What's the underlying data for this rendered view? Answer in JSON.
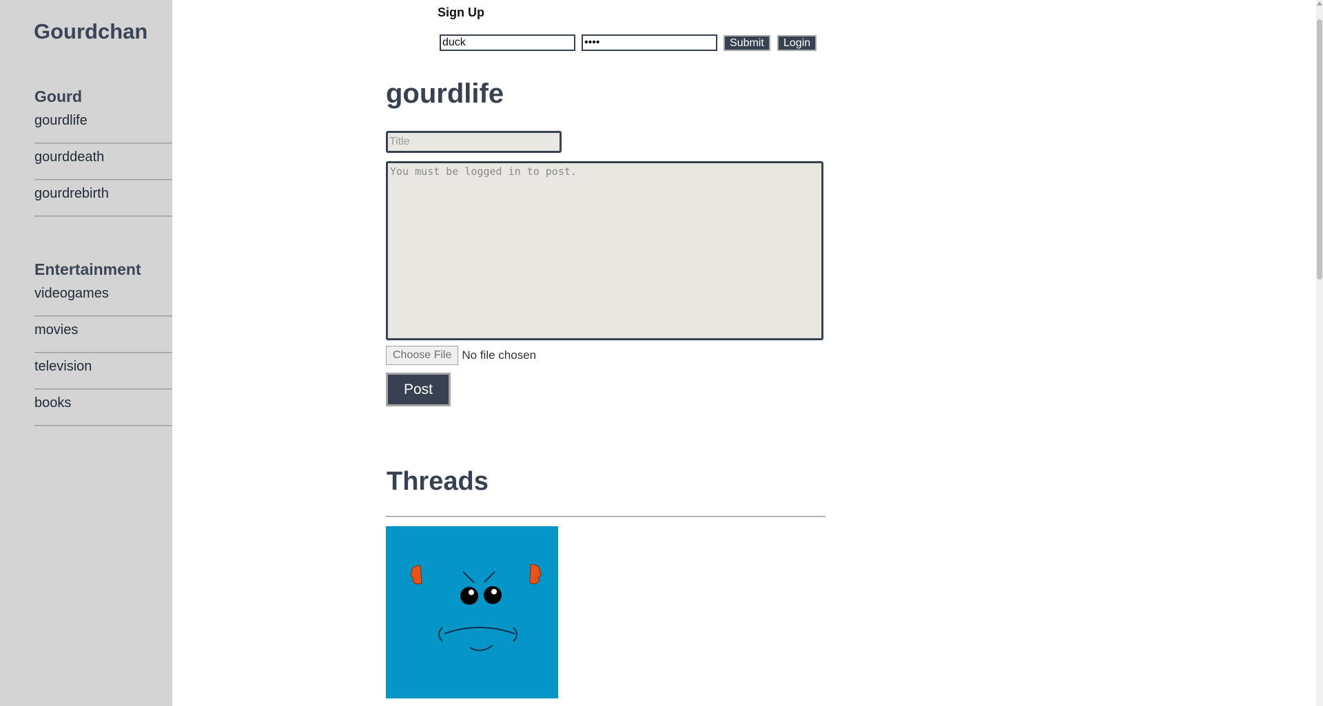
{
  "sidebar": {
    "site_title": "Gourdchan",
    "sections": [
      {
        "heading": "Gourd",
        "items": [
          {
            "label": "gourdlife"
          },
          {
            "label": "gourddeath"
          },
          {
            "label": "gourdrebirth"
          }
        ]
      },
      {
        "heading": "Entertainment",
        "items": [
          {
            "label": "videogames"
          },
          {
            "label": "movies"
          },
          {
            "label": "television"
          },
          {
            "label": "books"
          }
        ]
      }
    ]
  },
  "auth": {
    "signup_label": "Sign Up",
    "username_value": "duck",
    "password_value": "••••",
    "submit_label": "Submit",
    "login_label": "Login"
  },
  "board": {
    "title": "gourdlife",
    "title_placeholder": "Title",
    "body_placeholder": "You must be logged in to post.",
    "choose_file_label": "Choose File",
    "file_status": "No file chosen",
    "post_label": "Post"
  },
  "threads": {
    "heading": "Threads",
    "first_thread_image": "angry-blue-creature-face"
  },
  "colors": {
    "sidebar_bg": "#d4d4d4",
    "accent_dark": "#374151",
    "input_bg": "#e9e7e2",
    "thread_image_bg": "#0496c7"
  }
}
